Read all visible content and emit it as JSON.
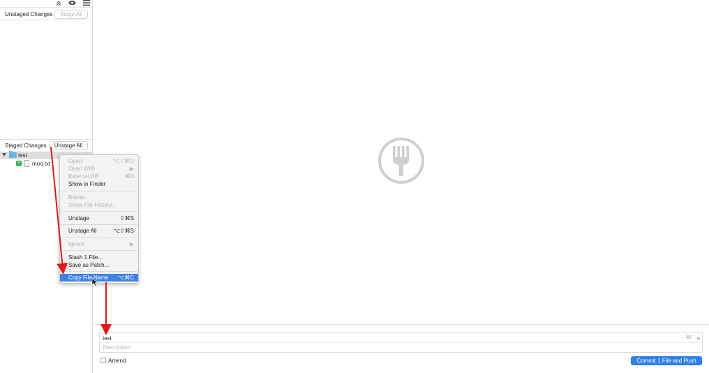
{
  "toolbar": {
    "icons": [
      "chevron-up-icon",
      "eye-icon",
      "hamburger-menu-icon"
    ]
  },
  "unstaged": {
    "title": "Unstaged Changes",
    "stage_all": "Stage All"
  },
  "staged": {
    "title": "Staged Changes",
    "unstage_all": "Unstage All",
    "tree": [
      {
        "type": "folder",
        "name": "test"
      },
      {
        "type": "file",
        "name": "moo.txt",
        "status": "+"
      }
    ]
  },
  "context_menu": {
    "items": [
      {
        "label": "Open",
        "shortcut": "⌥⇧⌘O",
        "enabled": false
      },
      {
        "label": "Open With",
        "shortcut": "▶",
        "enabled": false
      },
      {
        "label": "External Diff",
        "shortcut": "⌘D",
        "enabled": false
      },
      {
        "label": "Show in Finder",
        "shortcut": "",
        "enabled": true
      },
      {
        "label": "Blame...",
        "shortcut": "",
        "enabled": false
      },
      {
        "label": "Show File History...",
        "shortcut": "",
        "enabled": false
      },
      {
        "label": "Unstage",
        "shortcut": "⇧⌘S",
        "enabled": true
      },
      {
        "label": "Unstage All",
        "shortcut": "⌥⇧⌘S",
        "enabled": true
      },
      {
        "label": "Ignore",
        "shortcut": "▶",
        "enabled": false
      },
      {
        "label": "Stash 1 File...",
        "shortcut": "",
        "enabled": true
      },
      {
        "label": "Save as Patch...",
        "shortcut": "",
        "enabled": true
      },
      {
        "label": "Copy File Name",
        "shortcut": "⌥⌘C",
        "enabled": true,
        "selected": true
      }
    ]
  },
  "commit": {
    "summary": "test",
    "counter": "46",
    "description_placeholder": "Description",
    "amend_label": "Amend",
    "commit_button": "Commit 1 File and Push"
  },
  "colors": {
    "accent": "#3f82e6",
    "annotation_arrow": "#e01a1a",
    "added_status": "#35b34a"
  }
}
